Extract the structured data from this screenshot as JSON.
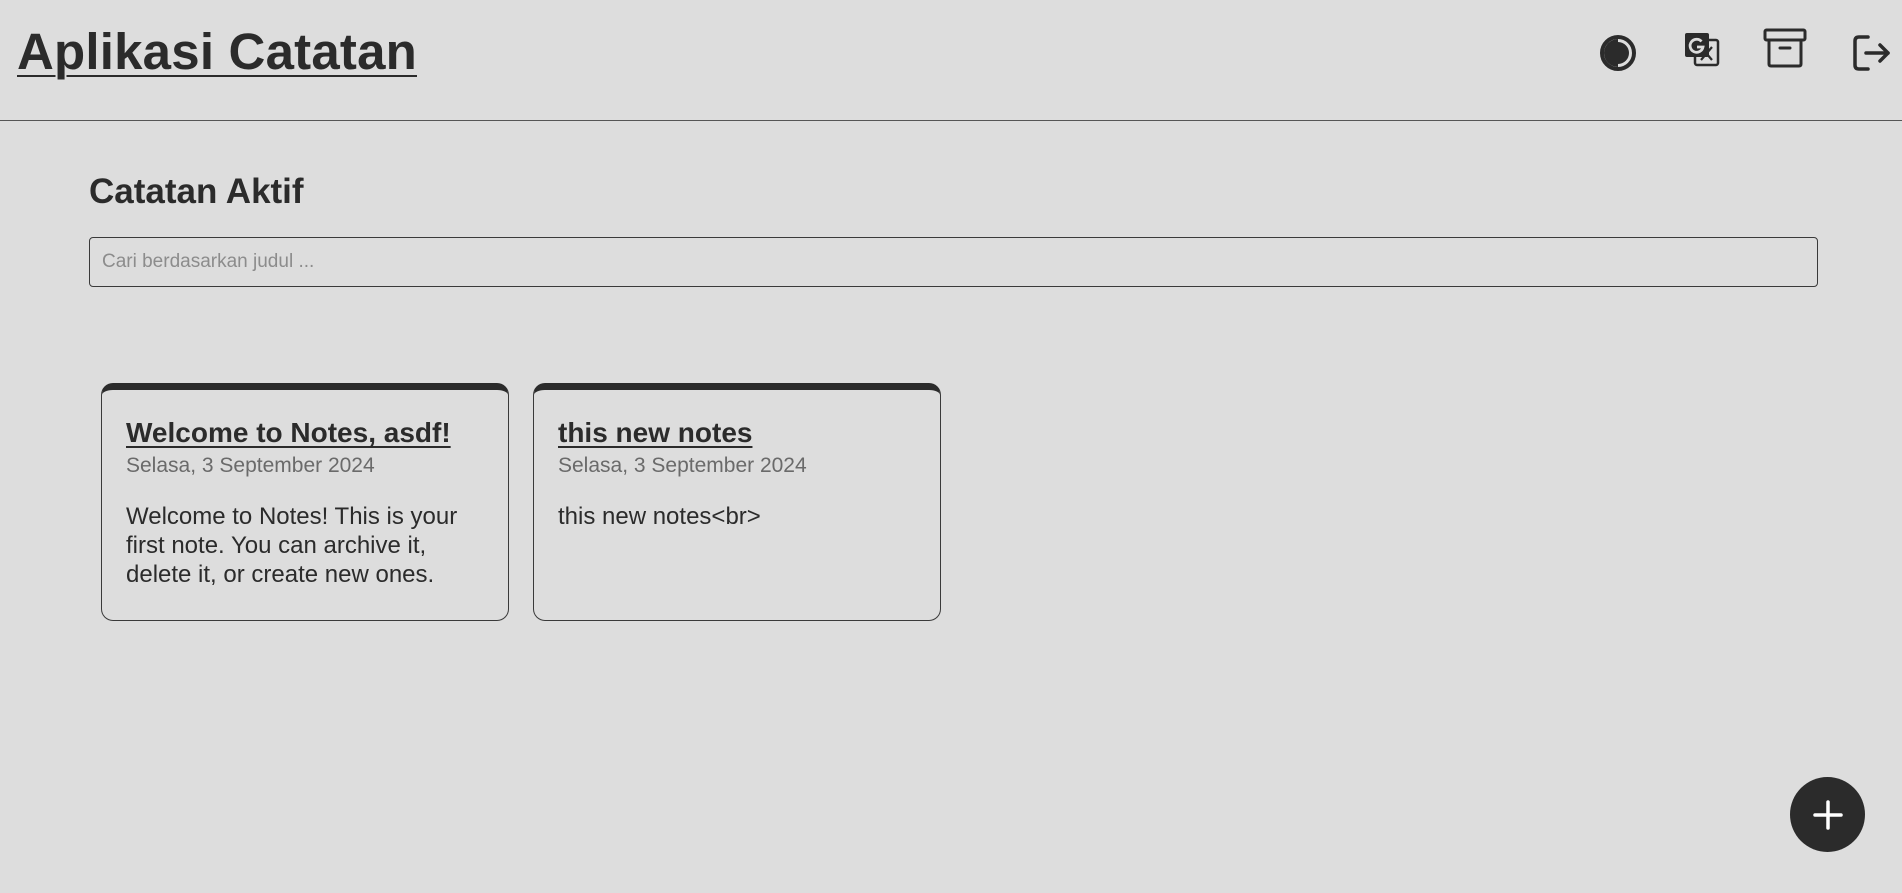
{
  "header": {
    "app_title": "Aplikasi Catatan",
    "icons": [
      "theme-toggle-icon",
      "translate-icon",
      "archive-icon",
      "logout-icon"
    ]
  },
  "main": {
    "section_title": "Catatan Aktif",
    "search": {
      "placeholder": "Cari berdasarkan judul ...",
      "value": ""
    },
    "notes": [
      {
        "title": "Welcome to Notes, asdf!",
        "date": "Selasa, 3 September 2024",
        "body": "Welcome to Notes! This is your first note. You can archive it, delete it, or create new ones."
      },
      {
        "title": "this new notes",
        "date": "Selasa, 3 September 2024",
        "body": "this new notes<br>"
      }
    ]
  },
  "fab": {
    "icon": "plus-icon"
  },
  "colors": {
    "background": "#dddddd",
    "text": "#2b2b2b",
    "muted_text": "#6a6a6a",
    "fab_background": "#2b2b2b"
  }
}
